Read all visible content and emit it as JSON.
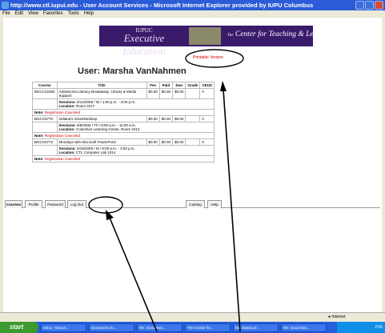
{
  "window": {
    "title": "http://www.ctl.iupui.edu - User Account Services - Microsoft Internet Explorer provided by IUPU Columbus"
  },
  "menu": [
    "File",
    "Edit",
    "View",
    "Favorites",
    "Tools",
    "Help"
  ],
  "banner": {
    "org": "IUPUC",
    "left_text": "Executive Education",
    "right_text": "Center for Teaching & Learning",
    "right_prefix": "The"
  },
  "printable_link": "Printable Version",
  "heading": "User: Marsha VanNahmen",
  "table": {
    "headers": [
      "Course",
      "Title",
      "Fee",
      "Paid",
      "Due",
      "Grade",
      "CEUS"
    ],
    "rows": [
      {
        "course": "BGCC22450",
        "title": "Adolescent Literacy Breakaway: Library & Media Support",
        "fee": "$0.00",
        "paid": "$0.00",
        "due": "$0.00",
        "grade": "",
        "ceus": "0",
        "sessions_label": "Sessions:",
        "sessions": "6/14/2006 / W / 1:00 p.m. - 3:00 p.m.",
        "location_label": "Location:",
        "location": "Room 221T",
        "note_label": "Note:",
        "note": "Registration Canceled"
      },
      {
        "course": "BGCC5770",
        "title": "Indiana's SmartDesktop",
        "fee": "$0.00",
        "paid": "$0.00",
        "due": "$0.00",
        "grade": "",
        "ceus": "0",
        "sessions_label": "Sessions:",
        "sessions": "6/8/2006 / Th / 9:00 a.m. - 11:00 a.m.",
        "location_label": "Location:",
        "location": "Columbus Learning Center, Room 2212",
        "note_label": "Note:",
        "note": "Registration Canceled"
      },
      {
        "course": "BGCC5773",
        "title": "Mondays with Microsoft PowerPoint",
        "fee": "$0.00",
        "paid": "$0.00",
        "due": "$0.00",
        "grade": "",
        "ceus": "0",
        "sessions_label": "Sessions:",
        "sessions": "6/19/2006 / M / 9:00 a.m. - 3:00 p.m.",
        "location_label": "Location:",
        "location": "CTL Computer Lab 1014",
        "note_label": "Note:",
        "note": "Registration Canceled"
      }
    ]
  },
  "tabs": [
    "Courses",
    "Profile",
    "Password",
    "Log Out",
    "Catalog",
    "Help"
  ],
  "status": {
    "zone": "Internet"
  },
  "taskbar": {
    "start": "start",
    "items": [
      "Inbox - Micros...",
      "Documents fo...",
      "RE: Good Mon...",
      "The Center for...",
      "http://www.ctl...",
      "RE: Good Mon..."
    ],
    "clock": "2:06"
  },
  "colors": {
    "banner_bg": "#3a1a6b",
    "note_red": "#cc0000",
    "annotation": "#000000"
  }
}
